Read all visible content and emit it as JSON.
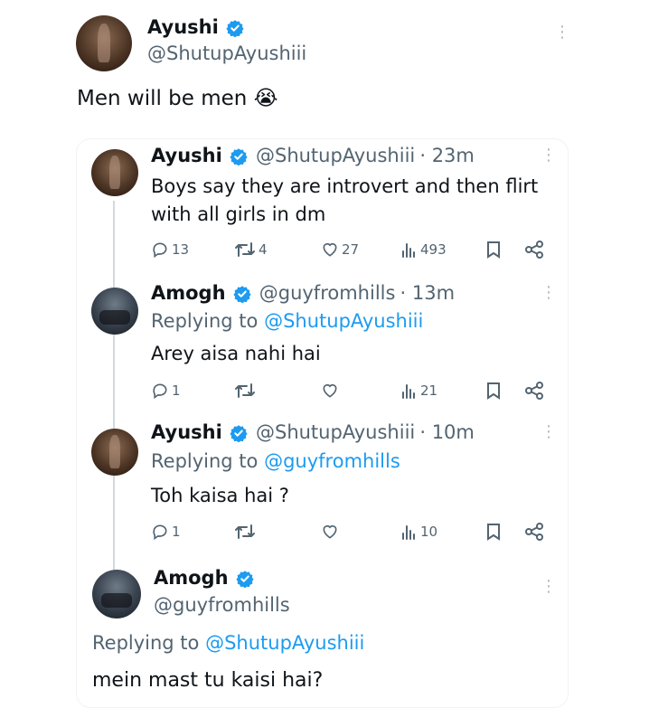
{
  "main_tweet": {
    "name": "Ayushi",
    "handle": "@ShutupAyushiii",
    "text": "Men will be men 😭"
  },
  "quoted_thread": [
    {
      "name": "Ayushi",
      "handle": "@ShutupAyushiii",
      "time": "· 23m",
      "text_line1": "Boys say they are introvert and then flirt",
      "text_line2": "with all girls in dm",
      "replies": "13",
      "retweets": "4",
      "likes": "27",
      "views": "493"
    },
    {
      "name": "Amogh",
      "handle": "@guyfromhills",
      "time": "· 13m",
      "replying_prefix": "Replying to",
      "replying_to": "@ShutupAyushiii",
      "text": "Arey aisa nahi hai",
      "replies": "1",
      "views": "21"
    },
    {
      "name": "Ayushi",
      "handle": "@ShutupAyushiii",
      "time": "· 10m",
      "replying_prefix": "Replying to",
      "replying_to": "@guyfromhills",
      "text": "Toh kaisa hai ?",
      "replies": "1",
      "views": "10"
    }
  ],
  "final_reply": {
    "name": "Amogh",
    "handle": "@guyfromhills",
    "replying_prefix": "Replying to",
    "replying_to": "@ShutupAyushiii",
    "text": "mein mast tu kaisi hai?"
  },
  "colors": {
    "verified": "#1d9bf0",
    "link": "#1d9bf0",
    "muted": "#536471",
    "text": "#0f1419"
  }
}
